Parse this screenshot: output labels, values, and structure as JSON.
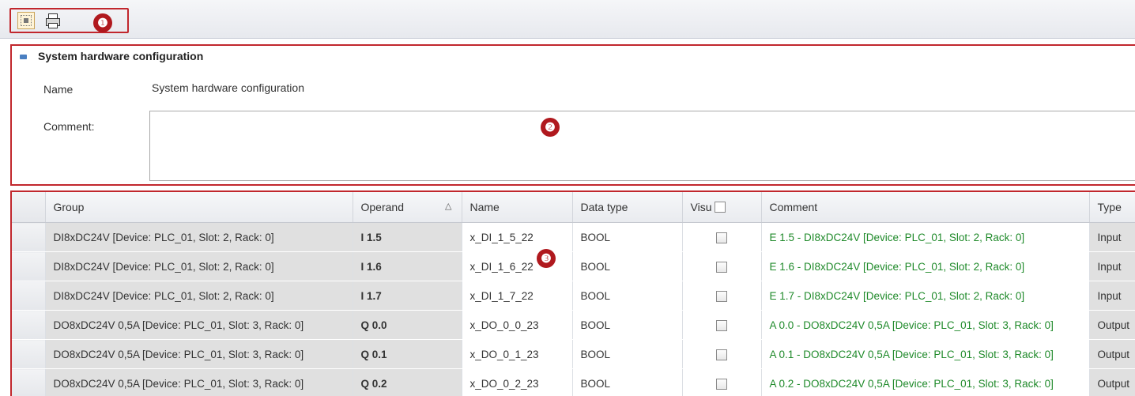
{
  "toolbar": {
    "badge": "❶",
    "view_icon": "grid-view-icon",
    "print_icon": "printer-icon"
  },
  "config": {
    "badge": "❷",
    "section_title": "System hardware configuration",
    "name_label": "Name",
    "name_value": "System hardware configuration",
    "comment_label": "Comment:",
    "comment_value": ""
  },
  "grid": {
    "badge": "❸",
    "columns": {
      "group": "Group",
      "operand": "Operand",
      "name": "Name",
      "data_type": "Data type",
      "visu": "Visu",
      "comment": "Comment",
      "type": "Type"
    },
    "sort_indicator": "△",
    "rows": [
      {
        "group": "DI8xDC24V [Device: PLC_01, Slot: 2, Rack: 0]",
        "operand": "I 1.5",
        "name": "x_DI_1_5_22",
        "data_type": "BOOL",
        "visu": false,
        "comment": "E 1.5 - DI8xDC24V [Device: PLC_01, Slot: 2, Rack: 0]",
        "type": "Input"
      },
      {
        "group": "DI8xDC24V [Device: PLC_01, Slot: 2, Rack: 0]",
        "operand": "I 1.6",
        "name": "x_DI_1_6_22",
        "data_type": "BOOL",
        "visu": false,
        "comment": "E 1.6 - DI8xDC24V [Device: PLC_01, Slot: 2, Rack: 0]",
        "type": "Input"
      },
      {
        "group": "DI8xDC24V [Device: PLC_01, Slot: 2, Rack: 0]",
        "operand": "I 1.7",
        "name": "x_DI_1_7_22",
        "data_type": "BOOL",
        "visu": false,
        "comment": "E 1.7 - DI8xDC24V [Device: PLC_01, Slot: 2, Rack: 0]",
        "type": "Input"
      },
      {
        "group": "DO8xDC24V 0,5A [Device: PLC_01, Slot: 3, Rack: 0]",
        "operand": "Q 0.0",
        "name": "x_DO_0_0_23",
        "data_type": "BOOL",
        "visu": false,
        "comment": "A 0.0 - DO8xDC24V 0,5A [Device: PLC_01, Slot: 3, Rack: 0]",
        "type": "Output"
      },
      {
        "group": "DO8xDC24V 0,5A [Device: PLC_01, Slot: 3, Rack: 0]",
        "operand": "Q 0.1",
        "name": "x_DO_0_1_23",
        "data_type": "BOOL",
        "visu": false,
        "comment": "A 0.1 - DO8xDC24V 0,5A [Device: PLC_01, Slot: 3, Rack: 0]",
        "type": "Output"
      },
      {
        "group": "DO8xDC24V 0,5A [Device: PLC_01, Slot: 3, Rack: 0]",
        "operand": "Q 0.2",
        "name": "x_DO_0_2_23",
        "data_type": "BOOL",
        "visu": false,
        "comment": "A 0.2 - DO8xDC24V 0,5A [Device: PLC_01, Slot: 3, Rack: 0]",
        "type": "Output"
      }
    ]
  },
  "colors": {
    "annotation_red": "#c1272d",
    "badge_red": "#b0191e",
    "comment_green": "#1f8a2a",
    "readonly_grey": "#e0e0e0"
  }
}
